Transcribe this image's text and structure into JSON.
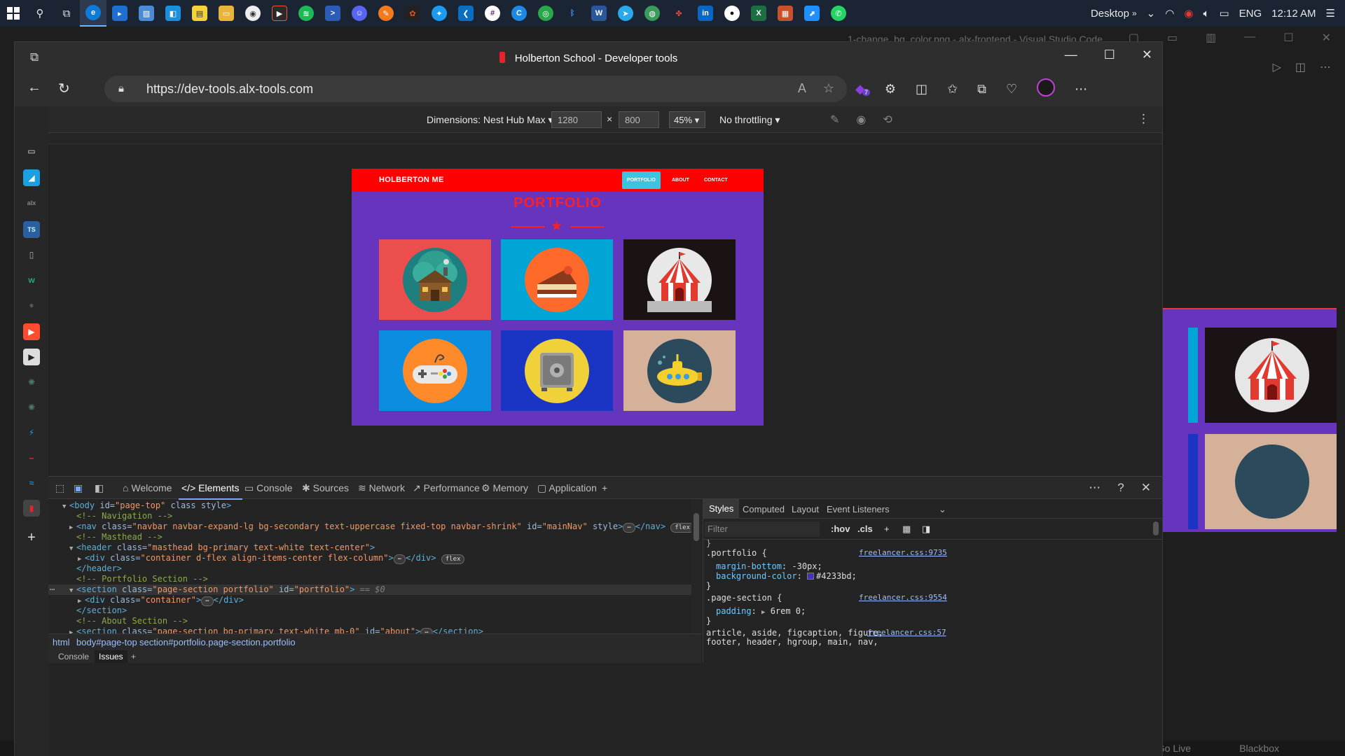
{
  "taskbar": {
    "desktop_label": "Desktop",
    "language": "ENG",
    "time": "12:12 AM"
  },
  "vscode": {
    "title": "1-change_bg_color.png - alx-frontend - Visual Studio Code",
    "status_golive": "Go Live",
    "status_blackbox": "Blackbox"
  },
  "browser": {
    "window_title": "Holberton School - Developer tools",
    "url": "https://dev-tools.alx-tools.com",
    "extension_badge": "7"
  },
  "device_toolbar": {
    "dimensions_label": "Dimensions: Nest Hub Max",
    "width": "1280",
    "height": "800",
    "zoom": "45%",
    "throttling": "No throttling"
  },
  "page": {
    "brand": "HOLBERTON ME",
    "nav": [
      "PORTFOLIO",
      "ABOUT",
      "CONTACT"
    ],
    "heading": "PORTFOLIO",
    "colors": {
      "navbar": "#ff0000",
      "active_link": "#3bc3e0",
      "background": "#6735bd",
      "heading": "#ff1f1f"
    },
    "items": [
      {
        "name": "cabin-icon",
        "bg": "#ec4d4d"
      },
      {
        "name": "cake-icon",
        "bg": "#00a5d6"
      },
      {
        "name": "circus-tent-icon",
        "bg": "#1b1313"
      },
      {
        "name": "game-controller-icon",
        "bg": "#0b8ee0"
      },
      {
        "name": "safe-icon",
        "bg": "#1a34c4"
      },
      {
        "name": "submarine-icon",
        "bg": "#d6b19a"
      }
    ]
  },
  "devtools": {
    "tabs": [
      "Welcome",
      "Elements",
      "Console",
      "Sources",
      "Network",
      "Performance",
      "Memory",
      "Application"
    ],
    "active_tab": "Elements",
    "elements": {
      "l1_tag": "<body",
      "l1_attr": " id=",
      "l1_val": "\"page-top\"",
      "l1_attr2": " class style",
      "l1_tag_end": ">",
      "l2": "<!-- Navigation -->",
      "l3_tag": "<nav",
      "l3_attr": " class=",
      "l3_val": "\"navbar navbar-expand-lg bg-secondary text-uppercase fixed-top navbar-shrink\"",
      "l3_attr2": " id=",
      "l3_val2": "\"mainNav\"",
      "l3_attr3": " style",
      "l3_tag_end": ">",
      "ellipsis": "⋯",
      "l3_close": "</nav>",
      "badge_flex": "flex",
      "l4": "<!-- Masthead -->",
      "l5_tag": "<header",
      "l5_attr": " class=",
      "l5_val": "\"masthead bg-primary text-white text-center\"",
      "l5_tag_end": ">",
      "l6_tag": "<div",
      "l6_attr": " class=",
      "l6_val": "\"container d-flex align-items-center flex-column\"",
      "l6_tag_end": ">",
      "l6_close": "</div>",
      "l7": "</header>",
      "l8": "<!-- Portfolio Section -->",
      "l9_tag": "<section",
      "l9_attr": " class=",
      "l9_val": "\"page-section portfolio\"",
      "l9_attr2": " id=",
      "l9_val2": "\"portfolio\"",
      "l9_tag_end": ">",
      "l9_sel": "== $0",
      "l10_tag": "<div",
      "l10_attr": " class=",
      "l10_val": "\"container\"",
      "l10_tag_end": ">",
      "l10_close": "</div>",
      "l11": "</section>",
      "l12": "<!-- About Section -->",
      "l13_tag": "<section",
      "l13_attr": " class=",
      "l13_val": "\"page-section bg-primary text-white mb-0\"",
      "l13_attr2": " id=",
      "l13_val2": "\"about\"",
      "l13_tag_end": ">",
      "l13_close": "</section>"
    },
    "breadcrumbs": [
      "html",
      "body#page-top",
      "section#portfolio.page-section.portfolio"
    ],
    "drawer_tabs": [
      "Console",
      "Issues"
    ],
    "styles_tabs": [
      "Styles",
      "Computed",
      "Layout",
      "Event Listeners"
    ],
    "filter_placeholder": "Filter",
    "hov": ":hov",
    "cls": ".cls",
    "rules": {
      "r1_selector": ".portfolio {",
      "r1_src": "freelancer.css:9735",
      "r1_p1": "margin-bottom",
      "r1_v1": ": -30px;",
      "r1_p2": "background-color",
      "r1_v2": "#4233bd;",
      "r1_close": "}",
      "r2_selector": ".page-section {",
      "r2_src": "freelancer.css:9554",
      "r2_p1": "padding",
      "r2_v1": "6rem 0;",
      "r2_close": "}",
      "r3_selector": "article, aside, figcaption, figure,",
      "r3_selector2": "footer, header, hgroup, main, nav,",
      "r3_src": "freelancer.css:57"
    }
  }
}
